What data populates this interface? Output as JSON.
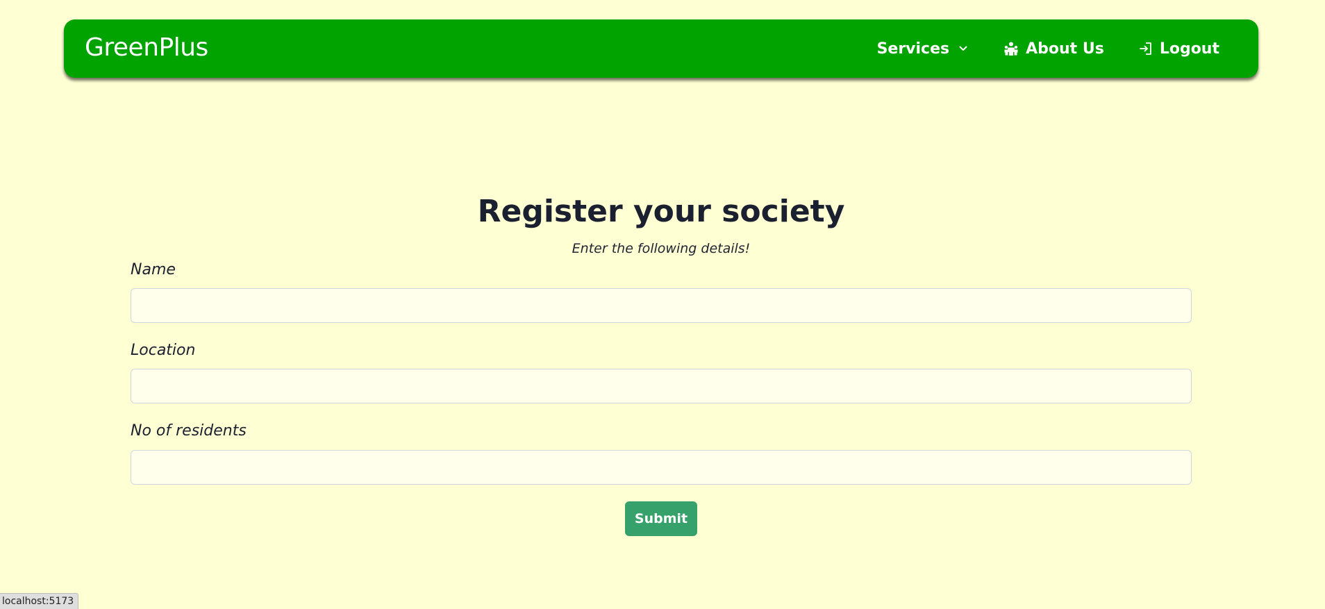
{
  "navbar": {
    "brand": "GreenPlus",
    "items": [
      {
        "label": "Services",
        "icon": "chevron-down-icon"
      },
      {
        "label": "About Us",
        "icon": "people-icon"
      },
      {
        "label": "Logout",
        "icon": "logout-icon"
      }
    ]
  },
  "main": {
    "title": "Register your society",
    "subtitle": "Enter the following details!",
    "fields": [
      {
        "label": "Name",
        "value": ""
      },
      {
        "label": "Location",
        "value": ""
      },
      {
        "label": "No of residents",
        "value": ""
      }
    ],
    "submit_label": "Submit"
  },
  "status_bar": {
    "url": "localhost:5173"
  },
  "colors": {
    "background": "#ffffd4",
    "navbar": "#00a300",
    "submit_button": "#36a16a",
    "input_background": "#ffffec"
  }
}
